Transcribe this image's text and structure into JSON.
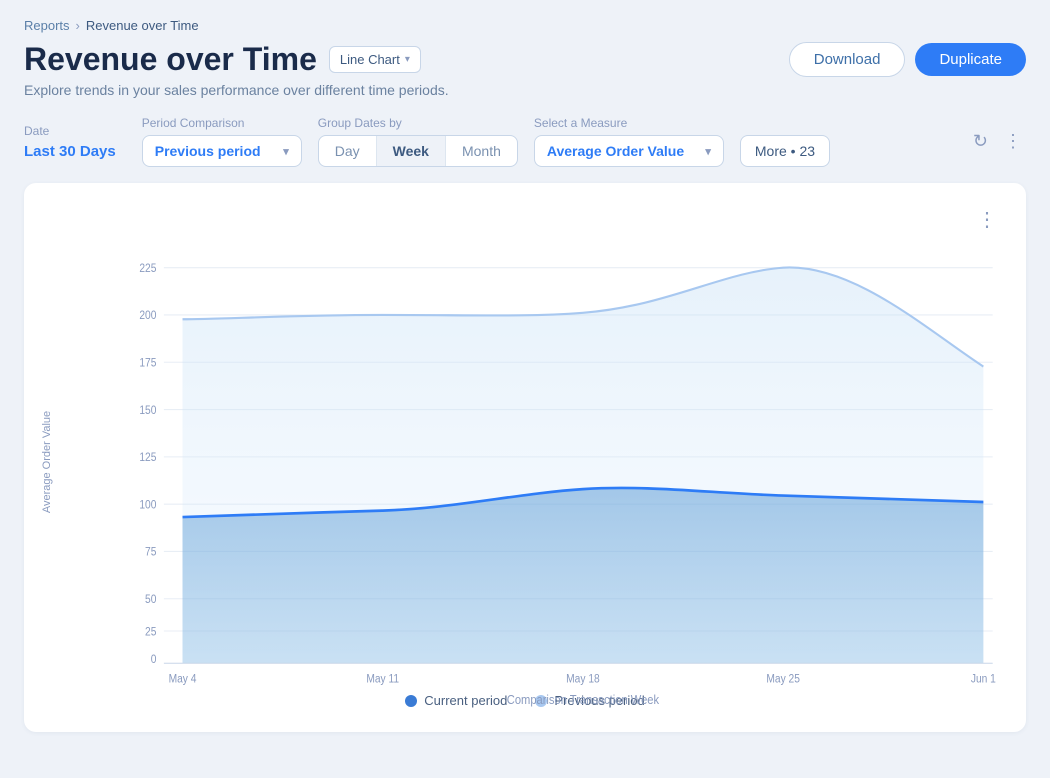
{
  "breadcrumb": {
    "parent": "Reports",
    "separator": "›",
    "current": "Revenue over Time"
  },
  "header": {
    "title": "Revenue over Time",
    "subtitle": "Explore trends in your sales performance over different time periods.",
    "chart_type_label": "Line Chart",
    "download_label": "Download",
    "duplicate_label": "Duplicate"
  },
  "filters": {
    "date_label": "Date",
    "date_value": "Last 30 Days",
    "period_label": "Period Comparison",
    "period_value": "Previous period",
    "group_label": "Group Dates by",
    "group_options": [
      "Day",
      "Week",
      "Month"
    ],
    "group_active": "Week",
    "measure_label": "Select a Measure",
    "measure_value": "Average Order Value",
    "more_label": "More • 23"
  },
  "chart": {
    "y_axis_label": "Average Order Value",
    "x_axis_label": "Comparison Transaction Week",
    "y_ticks": [
      0,
      25,
      50,
      75,
      100,
      125,
      150,
      175,
      200,
      225
    ],
    "x_ticks": [
      "May 4",
      "May 11",
      "May 18",
      "May 25",
      "Jun 1"
    ],
    "legend": {
      "current_label": "Current period",
      "previous_label": "Previous period"
    }
  },
  "icons": {
    "refresh": "↻",
    "more_vert": "⋮",
    "chevron_down": "▾",
    "cursor": "↖"
  }
}
